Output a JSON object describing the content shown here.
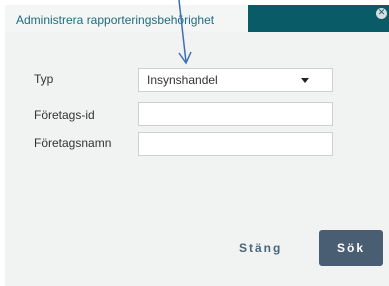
{
  "dialog": {
    "title": "Administrera rapporteringsbehörighet",
    "close_icon": "close-icon"
  },
  "form": {
    "type_label": "Typ",
    "type_value": "Insynshandel",
    "company_id_label": "Företags-id",
    "company_id_value": "",
    "company_name_label": "Företagsnamn",
    "company_name_value": ""
  },
  "buttons": {
    "close_label": "Stäng",
    "search_label": "Sök"
  },
  "colors": {
    "header_bar": "#0a5b68",
    "title_text": "#1f6c7f",
    "search_button": "#495e73",
    "annotation_arrow": "#3d6fb8"
  }
}
